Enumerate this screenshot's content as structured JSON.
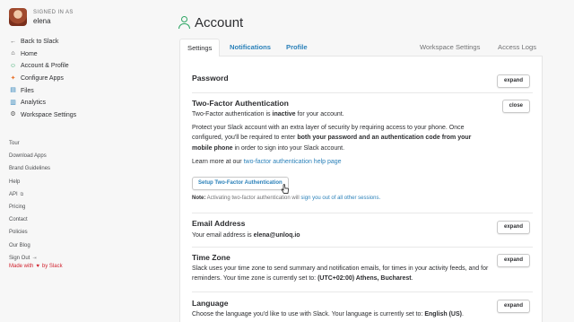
{
  "user": {
    "signed_in_label": "SIGNED IN AS",
    "name": "elena"
  },
  "nav": [
    {
      "label": "Back to Slack",
      "icon": "arrow-left-icon",
      "glyph": "←"
    },
    {
      "label": "Home",
      "icon": "home-icon",
      "glyph": "⌂"
    },
    {
      "label": "Account & Profile",
      "icon": "person-icon",
      "glyph": "☺"
    },
    {
      "label": "Configure Apps",
      "icon": "apps-icon",
      "glyph": "✦"
    },
    {
      "label": "Files",
      "icon": "files-icon",
      "glyph": "▤"
    },
    {
      "label": "Analytics",
      "icon": "analytics-icon",
      "glyph": "▥"
    },
    {
      "label": "Workspace Settings",
      "icon": "gear-icon",
      "glyph": "⚙"
    }
  ],
  "links": [
    "Tour",
    "Download Apps",
    "Brand Guidelines",
    "Help",
    "API",
    "Pricing",
    "Contact",
    "Policies",
    "Our Blog",
    "Sign Out"
  ],
  "made_with": {
    "prefix": "Made with",
    "suffix": "by Slack"
  },
  "page": {
    "title": "Account"
  },
  "tabs": {
    "settings": "Settings",
    "notifications": "Notifications",
    "profile": "Profile",
    "workspace_settings": "Workspace Settings",
    "access_logs": "Access Logs"
  },
  "password": {
    "title": "Password",
    "button": "expand"
  },
  "two_factor": {
    "title": "Two-Factor Authentication",
    "button": "close",
    "status_pre": "Two-Factor authentication is ",
    "status_word": "inactive",
    "status_post": " for your account.",
    "desc_1": "Protect your Slack account with an extra layer of security by requiring access to your phone. Once configured, you'll be required to enter ",
    "desc_bold_1": "both your password and an authentication code from your mobile phone",
    "desc_2": " in order to sign into your Slack account.",
    "learn_pre": "Learn more at our ",
    "learn_link": "two-factor authentication help page",
    "setup_button": "Setup Two-Factor Authentication",
    "note_label": "Note:",
    "note_text": " Activating two-factor authentication will ",
    "note_link": "sign you out of all other sessions."
  },
  "email": {
    "title": "Email Address",
    "button": "expand",
    "text_pre": "Your email address is ",
    "address": "elena@unloq.io"
  },
  "timezone": {
    "title": "Time Zone",
    "button": "expand",
    "text": "Slack uses your time zone to send summary and notification emails, for times in your activity feeds, and for reminders. Your time zone is currently set to: ",
    "value": "(UTC+02:00) Athens, Bucharest",
    "end": "."
  },
  "language": {
    "title": "Language",
    "button": "expand",
    "text": "Choose the language you'd like to use with Slack. Your language is currently set to: ",
    "value": "English (US)",
    "end": "."
  }
}
